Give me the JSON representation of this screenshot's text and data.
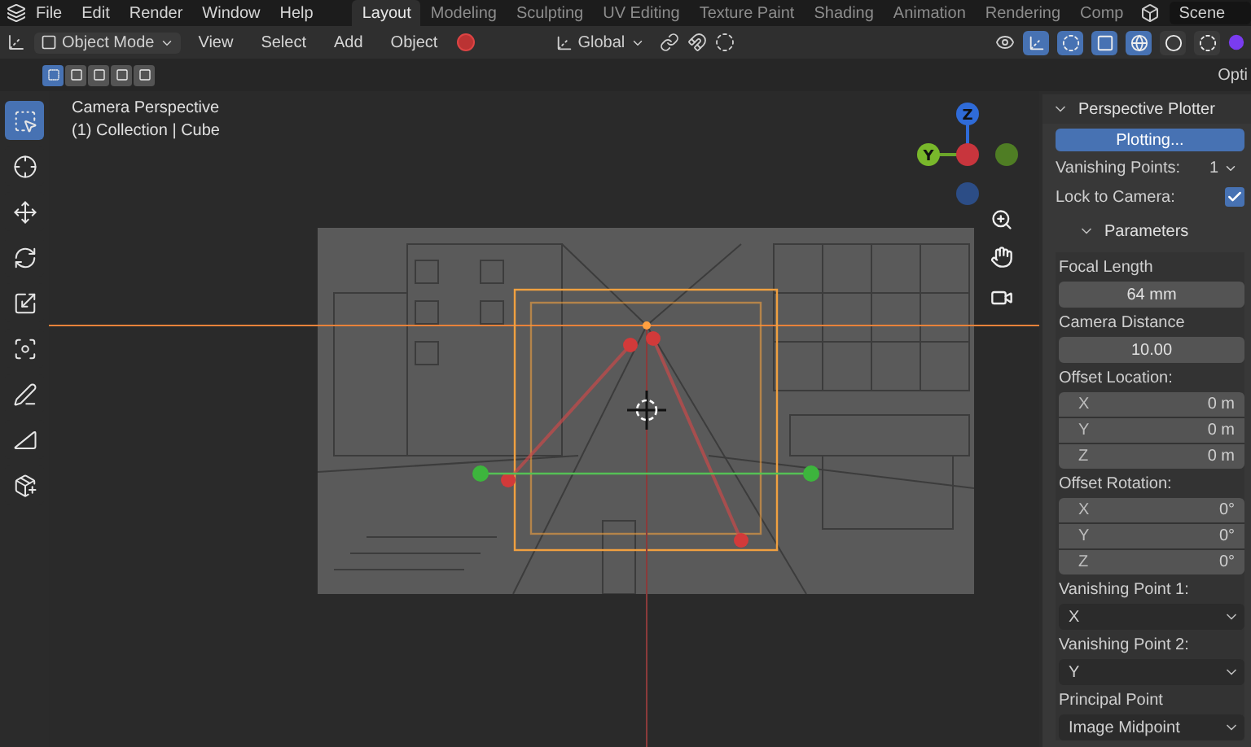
{
  "menu": [
    "File",
    "Edit",
    "Render",
    "Window",
    "Help"
  ],
  "workspaces": [
    {
      "label": "Layout",
      "selected": true
    },
    {
      "label": "Modeling",
      "selected": false
    },
    {
      "label": "Sculpting",
      "selected": false
    },
    {
      "label": "UV Editing",
      "selected": false
    },
    {
      "label": "Texture Paint",
      "selected": false
    },
    {
      "label": "Shading",
      "selected": false
    },
    {
      "label": "Animation",
      "selected": false
    },
    {
      "label": "Rendering",
      "selected": false
    },
    {
      "label": "Comp",
      "selected": false
    }
  ],
  "scene": "Scene",
  "header": {
    "mode": "Object Mode",
    "menus": [
      "View",
      "Select",
      "Add",
      "Object"
    ],
    "orientation": "Global",
    "toggles": [
      {
        "kind": "gizmo",
        "on": true
      },
      {
        "kind": "overlay",
        "on": true
      },
      {
        "kind": "xray",
        "on": true
      }
    ],
    "shading": [
      {
        "kind": "wireframe",
        "selected": true
      },
      {
        "kind": "solid",
        "selected": false
      },
      {
        "kind": "material",
        "selected": false
      }
    ]
  },
  "select_modes": [
    {
      "kind": "new",
      "selected": true
    },
    {
      "kind": "extend",
      "selected": false
    },
    {
      "kind": "subtract",
      "selected": false
    },
    {
      "kind": "invert",
      "selected": false
    },
    {
      "kind": "intersect",
      "selected": false
    }
  ],
  "options": "Opti",
  "tools": [
    {
      "kind": "select",
      "selected": true
    },
    {
      "kind": "cursor",
      "selected": false
    },
    {
      "kind": "move",
      "selected": false
    },
    {
      "kind": "rotate",
      "selected": false
    },
    {
      "kind": "scale",
      "selected": false
    },
    {
      "kind": "transform",
      "selected": false
    },
    {
      "kind": "annotate",
      "selected": false
    },
    {
      "kind": "measure",
      "selected": false
    },
    {
      "kind": "add_cube",
      "selected": false
    }
  ],
  "viewport": {
    "title": "Camera Perspective",
    "subtitle": "(1) Collection | Cube",
    "gizmo": {
      "z": "Z",
      "y": "Y"
    }
  },
  "panel": {
    "title": "Perspective Plotter",
    "expanded": true,
    "action": "Plotting...",
    "vanishing_points": {
      "label": "Vanishing Points:",
      "value": "1"
    },
    "lock_to_camera": {
      "label": "Lock to Camera:",
      "checked": true
    },
    "parameters": {
      "title": "Parameters",
      "expanded": true,
      "items": [
        {
          "kind": "label",
          "text": "Focal Length"
        },
        {
          "kind": "number",
          "value": "64 mm"
        },
        {
          "kind": "label",
          "text": "Camera Distance"
        },
        {
          "kind": "number",
          "value": "10.00"
        },
        {
          "kind": "label",
          "text": "Offset Location:"
        },
        {
          "kind": "vector",
          "rows": [
            {
              "axis": "X",
              "value": "0 m"
            },
            {
              "axis": "Y",
              "value": "0 m"
            },
            {
              "axis": "Z",
              "value": "0 m"
            }
          ]
        },
        {
          "kind": "label",
          "text": "Offset Rotation:"
        },
        {
          "kind": "vector",
          "rows": [
            {
              "axis": "X",
              "value": "0°"
            },
            {
              "axis": "Y",
              "value": "0°"
            },
            {
              "axis": "Z",
              "value": "0°"
            }
          ]
        },
        {
          "kind": "label",
          "text": "Vanishing Point 1:"
        },
        {
          "kind": "dropdown",
          "value": "X"
        },
        {
          "kind": "label",
          "text": "Vanishing Point 2:"
        },
        {
          "kind": "dropdown",
          "value": "Y"
        },
        {
          "kind": "label",
          "text": "Principal Point"
        },
        {
          "kind": "dropdown",
          "value": "Image Midpoint"
        }
      ]
    }
  }
}
